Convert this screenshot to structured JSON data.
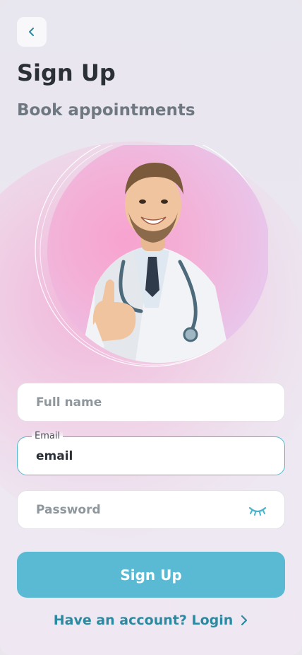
{
  "header": {
    "back_icon": "chevron-left-icon",
    "title": "Sign Up",
    "subtitle": "Book appointments"
  },
  "hero": {
    "subject": "smiling doctor with stethoscope giving thumbs up"
  },
  "form": {
    "full_name": {
      "value": "",
      "placeholder": "Full name"
    },
    "email": {
      "label": "Email",
      "value": "email",
      "placeholder": "email"
    },
    "password": {
      "value": "",
      "placeholder": "Password",
      "toggle_icon": "eye-closed-icon"
    }
  },
  "actions": {
    "signup_label": "Sign Up",
    "login_text": "Have an account? Login",
    "login_icon": "chevron-right-icon"
  },
  "colors": {
    "accent": "#5bbad3",
    "link": "#2b8aa1",
    "title": "#2b2f36",
    "subtitle": "#6f7880",
    "focus_border": "#53b9cf"
  }
}
